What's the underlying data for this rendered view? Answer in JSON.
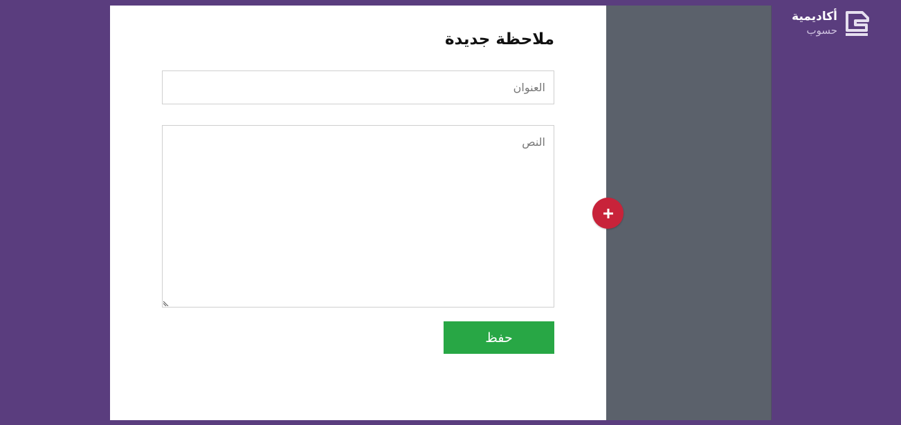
{
  "note_form": {
    "title": "ملاحظة جديدة",
    "title_field_placeholder": "العنوان",
    "title_field_value": "",
    "body_field_placeholder": "النص",
    "body_field_value": "",
    "save_label": "حفظ"
  },
  "add_button": {
    "icon": "plus-icon"
  },
  "brand": {
    "name": "أكاديمية",
    "sub": "حسوب",
    "logo_icon": "hsoub-logo-icon"
  },
  "colors": {
    "page_background": "#5a3d7e",
    "panel_background": "#ffffff",
    "sidebar_background": "#5b616b",
    "save_button": "#28a745",
    "add_button": "#c8233a"
  }
}
